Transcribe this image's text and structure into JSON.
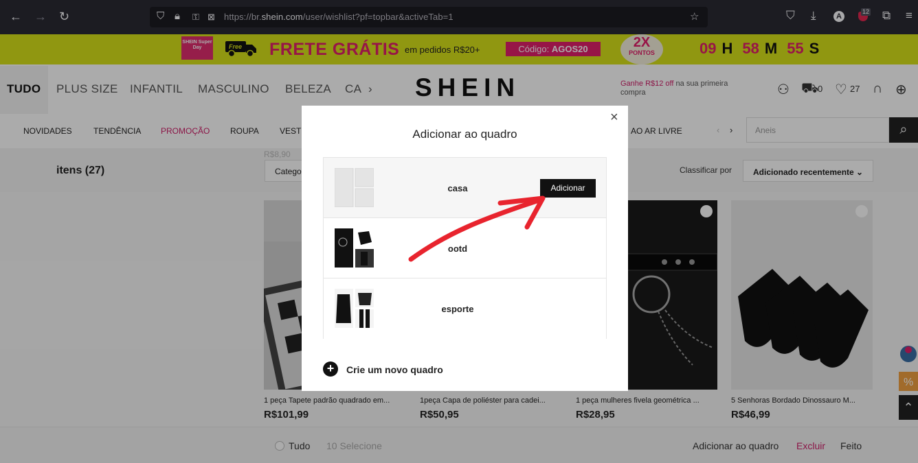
{
  "browser": {
    "url_prefix": "https://br.",
    "url_domain": "shein.com",
    "url_path": "/user/wishlist?pf=topbar&activeTab=1",
    "extension_badge": "12",
    "profile_letter": "A",
    "icons": [
      "back-icon",
      "forward-icon",
      "reload-icon",
      "shield-icon",
      "lock-icon",
      "permissions-icon",
      "bookmark-star-icon",
      "pocket-icon",
      "download-icon",
      "extensions-icon",
      "menu-icon"
    ]
  },
  "promo": {
    "superday": "SHEIN Super Day",
    "free": "Free",
    "frete": "FRETE GRÁTIS",
    "pedidos": "em pedidos R$20+",
    "codigo_label": "Código:",
    "codigo": "AGOS20",
    "pontos_big": "2X",
    "pontos_small": "PONTOS",
    "timer": {
      "h": "09",
      "h_unit": "H",
      "m": "58",
      "m_unit": "M",
      "s": "55",
      "s_unit": "S"
    }
  },
  "header": {
    "categories": [
      "TUDO",
      "PLUS SIZE",
      "INFANTIL",
      "MASCULINO",
      "BELEZA",
      "CA"
    ],
    "logo": "SHEIN",
    "ganhe_red": "Ganhe R$12 off",
    "ganhe_rest": " na sua primeira compra",
    "cart_count": "0",
    "wishlist_count": "27",
    "subnav": [
      "NOVIDADES",
      "TENDÊNCIA",
      "PROMOÇÃO",
      "ROUPA",
      "VEST",
      "AO AR LIVRE"
    ],
    "search_placeholder": "Aneis"
  },
  "wishlist": {
    "items_label": "itens (27)",
    "category_btn": "Catego",
    "ghost_price": "R$8,90",
    "sort_label": "Classificar por",
    "sort_value": "Adicionado recentemente",
    "products": [
      {
        "title": "1 peça Tapete padrão quadrado em...",
        "price": "R$101,99"
      },
      {
        "title": "1peça Capa de poliéster para cadei...",
        "price": "R$50,95"
      },
      {
        "title": "1 peça mulheres fivela geométrica ...",
        "price": "R$28,95"
      },
      {
        "title": "5 Senhoras Bordado Dinossauro M...",
        "price": "R$46,99"
      }
    ],
    "bottom": {
      "tudo": "Tudo",
      "selecione": "10 Selecione",
      "add_board": "Adicionar ao quadro",
      "excluir": "Excluir",
      "feito": "Feito"
    }
  },
  "modal": {
    "title": "Adicionar ao quadro",
    "close": "×",
    "boards": [
      {
        "name": "casa",
        "button": "Adicionar"
      },
      {
        "name": "ootd"
      },
      {
        "name": "esporte"
      }
    ],
    "new_board": "Crie um novo quadro",
    "plus": "+"
  },
  "annotation": {
    "arrow_color": "#e8242e"
  }
}
